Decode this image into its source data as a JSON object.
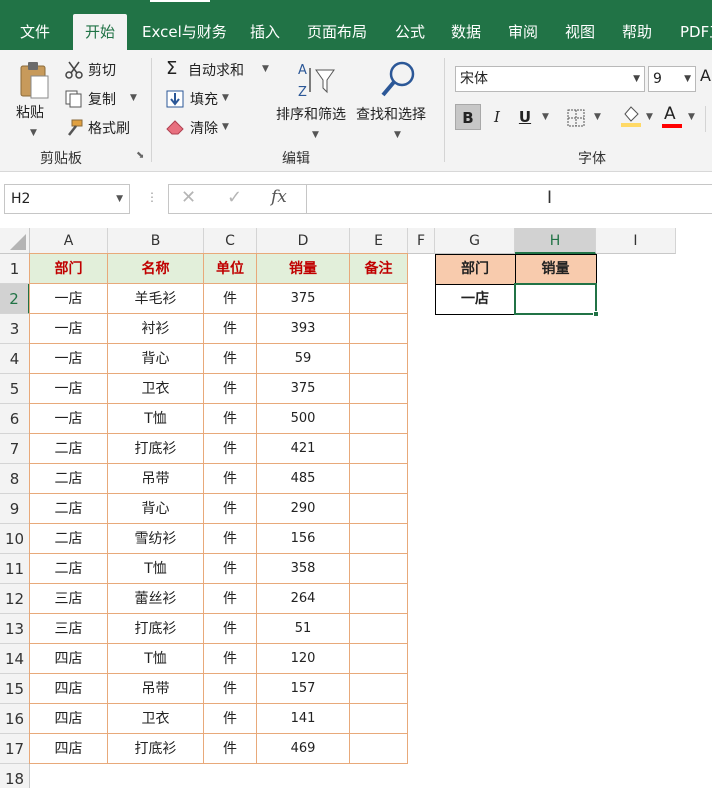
{
  "ribbon_tabs": [
    "文件",
    "开始",
    "Excel与财务",
    "插入",
    "页面布局",
    "公式",
    "数据",
    "审阅",
    "视图",
    "帮助",
    "PDF工"
  ],
  "active_tab": "开始",
  "clipboard": {
    "paste": "粘贴",
    "cut": "剪切",
    "copy": "复制",
    "format_painter": "格式刷",
    "group_label": "剪贴板"
  },
  "editing": {
    "autosum": "自动求和",
    "fill": "填充",
    "clear": "清除",
    "sort_filter": "排序和筛选",
    "find_select": "查找和选择",
    "group_label": "编辑"
  },
  "font": {
    "name": "宋体",
    "size": "9",
    "bold": "B",
    "italic": "I",
    "underline": "U",
    "font_color_glyph": "A",
    "group_label": "字体"
  },
  "formula_bar": {
    "name_box": "H2",
    "fx": "fx",
    "formula": ""
  },
  "columns": [
    "A",
    "B",
    "C",
    "D",
    "E",
    "F",
    "G",
    "H",
    "I"
  ],
  "selected_cell": {
    "column": "H",
    "row": 2
  },
  "row_numbers": [
    "1",
    "2",
    "3",
    "4",
    "5",
    "6",
    "7",
    "8",
    "9",
    "10",
    "11",
    "12",
    "13",
    "14",
    "15",
    "16",
    "17",
    "18"
  ],
  "table": {
    "headers": [
      "部门",
      "名称",
      "单位",
      "销量",
      "备注"
    ],
    "rows": [
      [
        "一店",
        "羊毛衫",
        "件",
        "375",
        ""
      ],
      [
        "一店",
        "衬衫",
        "件",
        "393",
        ""
      ],
      [
        "一店",
        "背心",
        "件",
        "59",
        ""
      ],
      [
        "一店",
        "卫衣",
        "件",
        "375",
        ""
      ],
      [
        "一店",
        "T恤",
        "件",
        "500",
        ""
      ],
      [
        "二店",
        "打底衫",
        "件",
        "421",
        ""
      ],
      [
        "二店",
        "吊带",
        "件",
        "485",
        ""
      ],
      [
        "二店",
        "背心",
        "件",
        "290",
        ""
      ],
      [
        "二店",
        "雪纺衫",
        "件",
        "156",
        ""
      ],
      [
        "二店",
        "T恤",
        "件",
        "358",
        ""
      ],
      [
        "三店",
        "蕾丝衫",
        "件",
        "264",
        ""
      ],
      [
        "三店",
        "打底衫",
        "件",
        "51",
        ""
      ],
      [
        "四店",
        "T恤",
        "件",
        "120",
        ""
      ],
      [
        "四店",
        "吊带",
        "件",
        "157",
        ""
      ],
      [
        "四店",
        "卫衣",
        "件",
        "141",
        ""
      ],
      [
        "四店",
        "打底衫",
        "件",
        "469",
        ""
      ]
    ]
  },
  "lookup": {
    "headers": [
      "部门",
      "销量"
    ],
    "department": "一店",
    "sales": ""
  },
  "colors": {
    "excel_green": "#217346",
    "header_fill": "#e2efda",
    "header_text": "#c00000",
    "lookup_header_fill": "#f8cbad",
    "table_border": "#e8a97a"
  }
}
